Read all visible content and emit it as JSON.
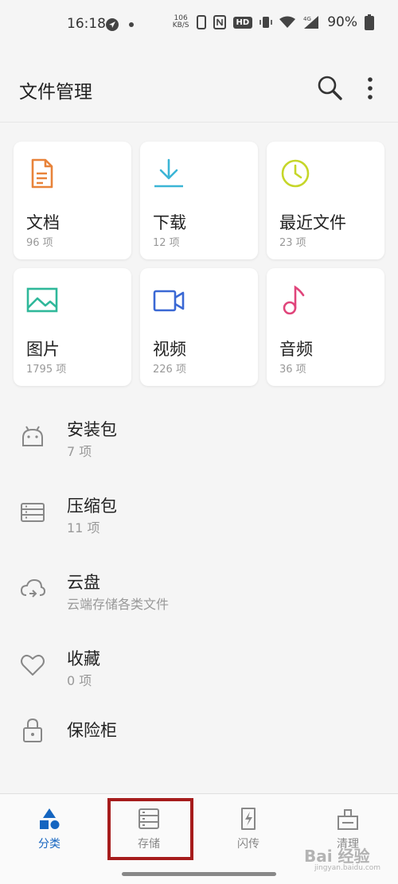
{
  "status_bar": {
    "time": "16:18",
    "net_speed_value": "106",
    "net_speed_unit": "KB/S",
    "hd": "HD",
    "signal": "4G",
    "battery": "90%"
  },
  "app_bar": {
    "title": "文件管理"
  },
  "categories": [
    {
      "label": "文档",
      "count": "96 项",
      "icon": "document-icon",
      "color": "#e8833a"
    },
    {
      "label": "下载",
      "count": "12 项",
      "icon": "download-icon",
      "color": "#3bb5d6"
    },
    {
      "label": "最近文件",
      "count": "23 项",
      "icon": "clock-icon",
      "color": "#c6d629"
    },
    {
      "label": "图片",
      "count": "1795 项",
      "icon": "image-icon",
      "color": "#2fb89a"
    },
    {
      "label": "视频",
      "count": "226 项",
      "icon": "video-icon",
      "color": "#3a68d4"
    },
    {
      "label": "音频",
      "count": "36 项",
      "icon": "music-icon",
      "color": "#e0457b"
    }
  ],
  "list": [
    {
      "title": "安装包",
      "sub": "7 项",
      "icon": "android-icon"
    },
    {
      "title": "压缩包",
      "sub": "11 项",
      "icon": "archive-icon"
    },
    {
      "title": "云盘",
      "sub": "云端存储各类文件",
      "icon": "cloud-icon"
    },
    {
      "title": "收藏",
      "sub": "0 项",
      "icon": "heart-icon"
    },
    {
      "title": "保险柜",
      "sub": "",
      "icon": "lock-icon"
    }
  ],
  "bottom_nav": [
    {
      "label": "分类",
      "icon": "category-icon",
      "active": true
    },
    {
      "label": "存储",
      "icon": "storage-icon",
      "active": false
    },
    {
      "label": "闪传",
      "icon": "flash-transfer-icon",
      "active": false
    },
    {
      "label": "清理",
      "icon": "clean-icon",
      "active": false
    }
  ],
  "watermark": {
    "text": "Bai 经验",
    "sub": "jingyan.baidu.com"
  },
  "colors": {
    "accent": "#1565c0",
    "highlight_box": "#a61c1c"
  }
}
